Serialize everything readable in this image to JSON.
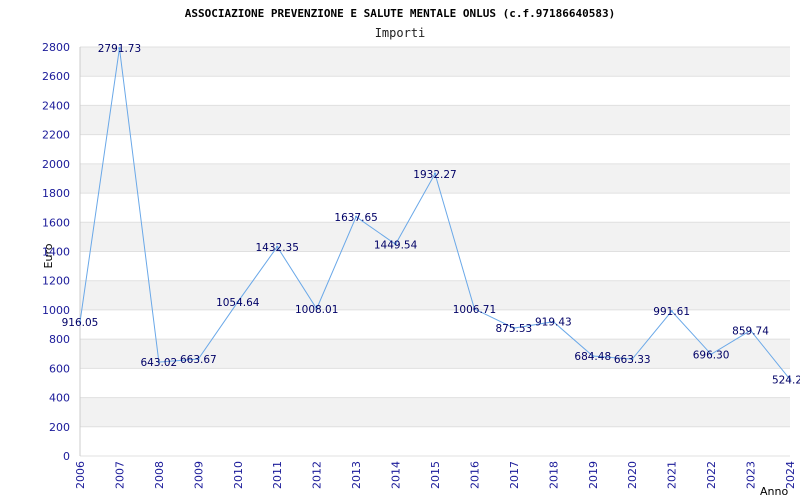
{
  "colors": {
    "background": "#ffffff",
    "band": "#f2f2f2",
    "gridline": "#e0e0e0",
    "line": "#6aa8e8",
    "tick_text": "#1a1a99",
    "label_text": "#000066"
  },
  "chart_data": {
    "type": "line",
    "title": "ASSOCIAZIONE PREVENZIONE E SALUTE MENTALE ONLUS (c.f.97186640583)",
    "subtitle": "Importi",
    "xlabel": "Anno",
    "ylabel": "Euro",
    "ylim": [
      0,
      2800
    ],
    "yticks": [
      0,
      200,
      400,
      600,
      800,
      1000,
      1200,
      1400,
      1600,
      1800,
      2000,
      2200,
      2400,
      2600,
      2800
    ],
    "grid": true,
    "categories": [
      "2006",
      "2007",
      "2008",
      "2009",
      "2010",
      "2011",
      "2012",
      "2013",
      "2014",
      "2015",
      "2016",
      "2017",
      "2018",
      "2019",
      "2020",
      "2021",
      "2022",
      "2023",
      "2024"
    ],
    "series": [
      {
        "values": [
          916.05,
          2791.73,
          643.02,
          663.67,
          1054.64,
          1432.35,
          1008.01,
          1637.65,
          1449.54,
          1932.27,
          1006.71,
          875.53,
          919.43,
          684.48,
          663.33,
          991.61,
          696.3,
          859.74,
          524.2
        ],
        "labels": [
          "916.05",
          "2791.73",
          "643.02",
          "663.67",
          "1054.64",
          "1432.35",
          "1008.01",
          "1637.65",
          "1449.54",
          "1932.27",
          "1006.71",
          "875.53",
          "919.43",
          "684.48",
          "663.33",
          "991.61",
          "696.30",
          "859.74",
          "524.2"
        ]
      }
    ]
  }
}
